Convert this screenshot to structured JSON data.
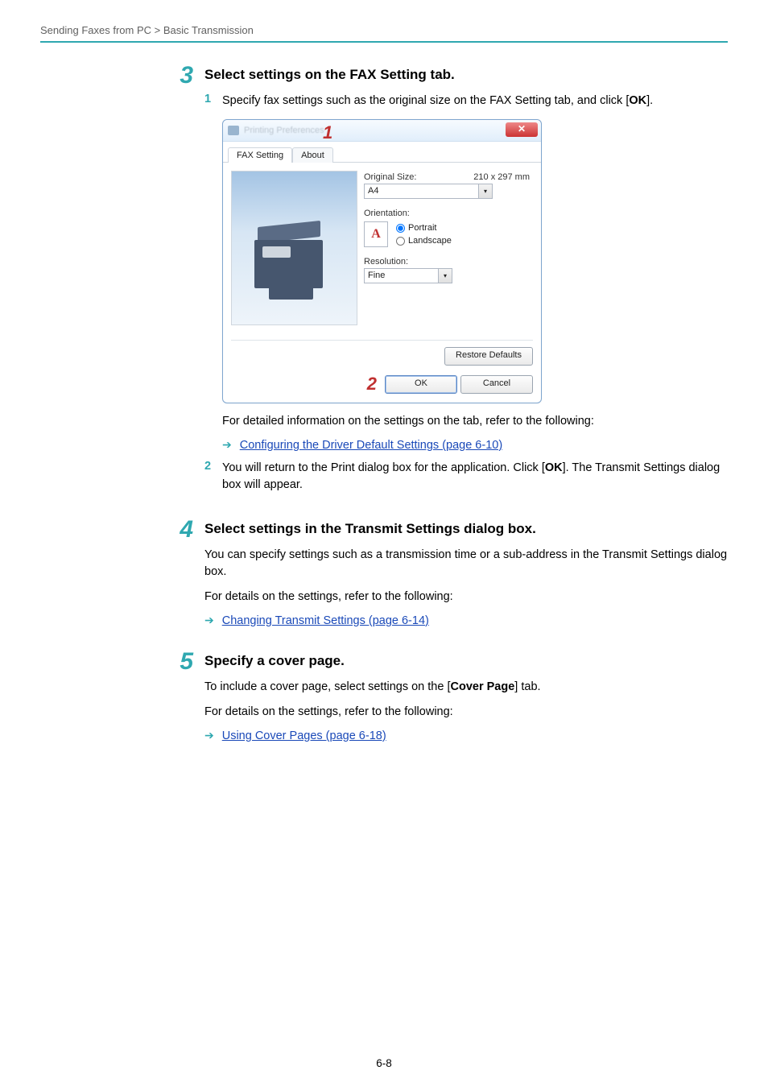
{
  "breadcrumb": "Sending Faxes from PC > Basic Transmission",
  "sections": {
    "s3": {
      "num": "3",
      "title": "Select settings on the FAX Setting tab.",
      "item1_num": "1",
      "item1_before": "Specify fax settings such as the original size on the FAX Setting tab, and click [",
      "item1_bold": "OK",
      "item1_after": "].",
      "info_line": "For detailed information on the settings on the tab, refer to the following:",
      "link1": "Configuring the Driver Default Settings (page 6-10)",
      "item2_num": "2",
      "item2_before": "You will return to the Print dialog box for the application. Click [",
      "item2_bold": "OK",
      "item2_after": "]. The Transmit Settings dialog box will appear."
    },
    "s4": {
      "num": "4",
      "title": "Select settings in the Transmit Settings dialog box.",
      "p1": "You can specify settings such as a transmission time or a sub-address in the Transmit Settings dialog box.",
      "p2": "For details on the settings, refer to the following:",
      "link": "Changing Transmit Settings (page 6-14)"
    },
    "s5": {
      "num": "5",
      "title": "Specify a cover page.",
      "p1_before": "To include a cover page, select settings on the [",
      "p1_bold": "Cover Page",
      "p1_after": "] tab.",
      "p2": "For details on the settings, refer to the following:",
      "link": "Using Cover Pages (page 6-18)"
    }
  },
  "dialog": {
    "tab_fax": "FAX Setting",
    "tab_about": "About",
    "original_size_label": "Original Size:",
    "original_size_dim": "210 x 297 mm",
    "original_size_value": "A4",
    "orientation_label": "Orientation:",
    "radio_portrait": "Portrait",
    "radio_landscape": "Landscape",
    "orient_icon_text": "A",
    "resolution_label": "Resolution:",
    "resolution_value": "Fine",
    "restore_btn": "Restore Defaults",
    "ok_btn": "OK",
    "cancel_btn": "Cancel",
    "callout1": "1",
    "callout2": "2",
    "close_glyph": "✕"
  },
  "page_number": "6-8"
}
